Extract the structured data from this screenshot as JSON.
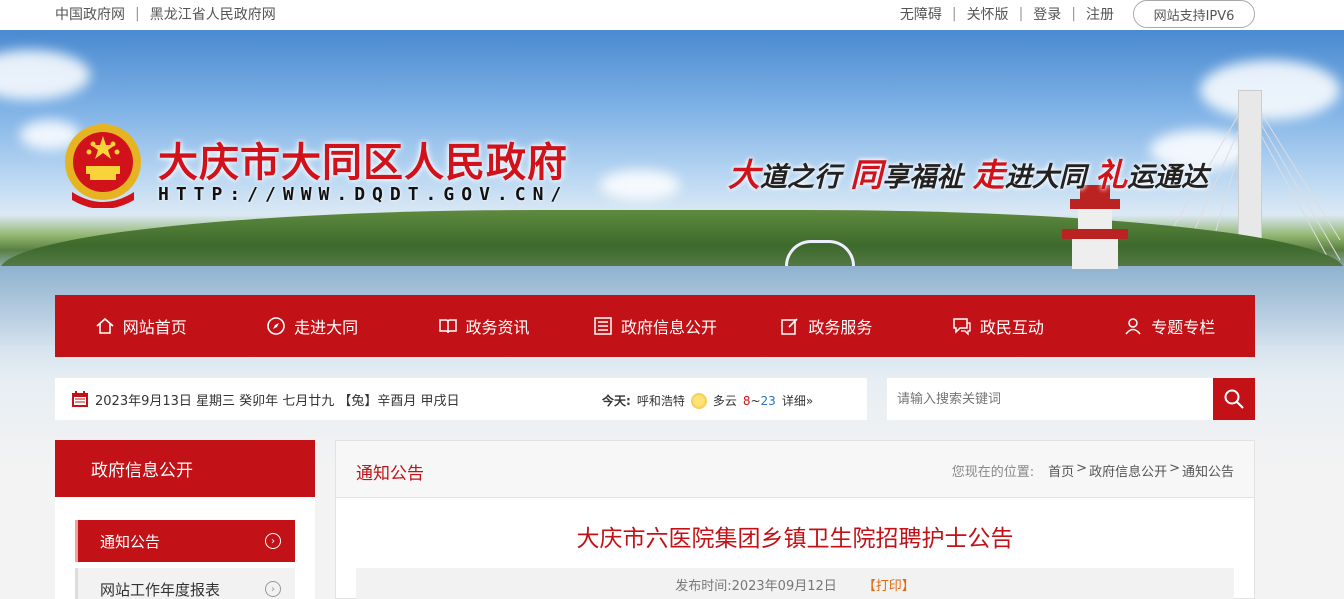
{
  "topbar": {
    "links_left": [
      "中国政府网",
      "黑龙江省人民政府网"
    ],
    "links_right": [
      "无障碍",
      "关怀版",
      "登录",
      "注册"
    ],
    "ipv6": "网站支持IPV6"
  },
  "header": {
    "title": "大庆市大同区人民政府",
    "url": "HTTP://WWW.DQDT.GOV.CN/",
    "slogan": [
      "大",
      "道之行 ",
      "同",
      "享福祉 ",
      "走",
      "进大同 ",
      "礼",
      "运通达"
    ]
  },
  "nav": {
    "items": [
      {
        "label": "网站首页",
        "icon": "home-icon"
      },
      {
        "label": "走进大同",
        "icon": "compass-icon"
      },
      {
        "label": "政务资讯",
        "icon": "book-icon"
      },
      {
        "label": "政府信息公开",
        "icon": "list-icon"
      },
      {
        "label": "政务服务",
        "icon": "edit-icon"
      },
      {
        "label": "政民互动",
        "icon": "chat-icon"
      },
      {
        "label": "专题专栏",
        "icon": "user-icon"
      }
    ]
  },
  "infobar": {
    "date": "2023年9月13日 星期三  癸卯年 七月廿九 【兔】辛酉月 甲戌日",
    "today_label": "今天:",
    "city": "呼和浩特",
    "weather": "多云",
    "temp_low": "8",
    "temp_sep": "~",
    "temp_high": "23",
    "detail": "详细»"
  },
  "search": {
    "placeholder": "请输入搜索关键词"
  },
  "sidebar": {
    "heading": "政府信息公开",
    "items": [
      {
        "label": "通知公告"
      },
      {
        "label": "网站工作年度报表"
      }
    ]
  },
  "main": {
    "section_title": "通知公告",
    "breadcrumb_label": "您现在的位置:",
    "breadcrumb": [
      "首页",
      ">",
      "政府信息公开",
      ">",
      "通知公告"
    ],
    "article_title": "大庆市六医院集团乡镇卫生院招聘护士公告",
    "publish_label": "发布时间:",
    "publish_date": "2023年09月12日",
    "print": "【打印】"
  },
  "colors": {
    "brand_red": "#c31217",
    "title_red": "#d1121b"
  }
}
